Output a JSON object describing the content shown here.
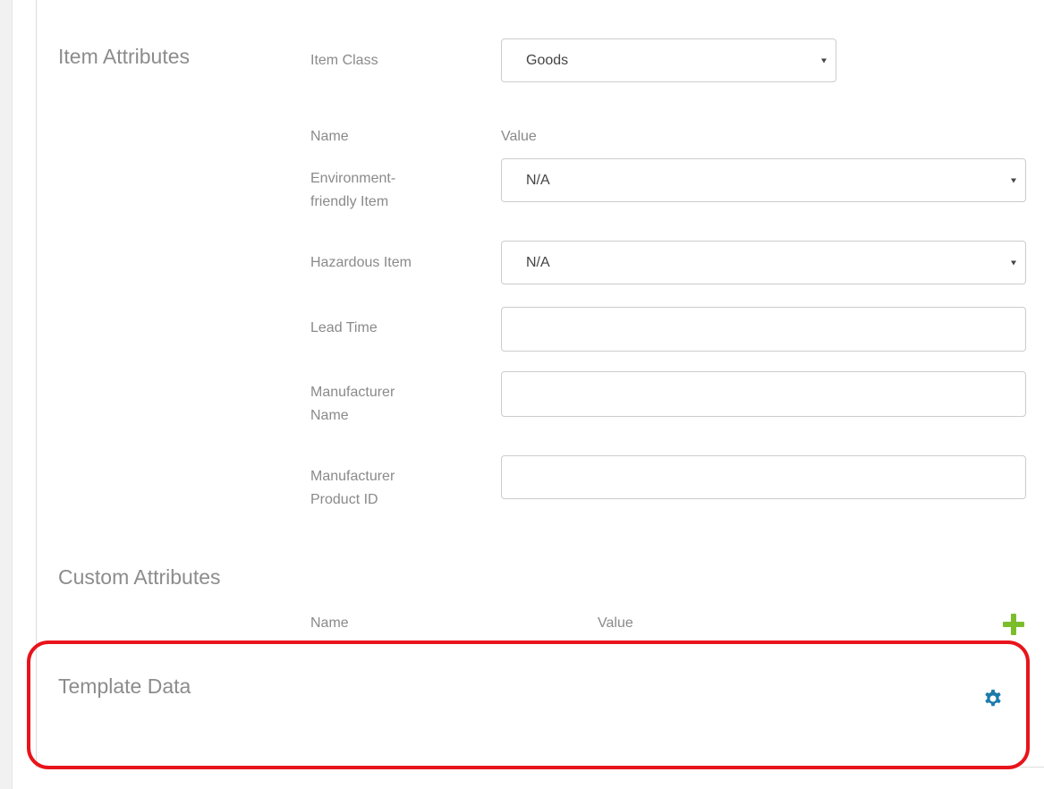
{
  "item_attributes": {
    "title": "Item Attributes",
    "item_class_label": "Item Class",
    "item_class_value": "Goods",
    "col_name": "Name",
    "col_value": "Value",
    "fields": [
      {
        "label_line1": "Environment-",
        "label_line2": "friendly Item",
        "value": "N/A"
      },
      {
        "label": "Hazardous Item",
        "value": "N/A"
      },
      {
        "label": "Lead Time",
        "value": ""
      },
      {
        "label_line1": "Manufacturer",
        "label_line2": "Name",
        "value": ""
      },
      {
        "label_line1": "Manufacturer",
        "label_line2": "Product ID",
        "value": ""
      }
    ]
  },
  "custom_attributes": {
    "title": "Custom Attributes",
    "col_name": "Name",
    "col_value": "Value",
    "add_icon": "plus-icon"
  },
  "template_data": {
    "title": "Template Data",
    "settings_icon": "gear-icon"
  },
  "colors": {
    "accent_green": "#7cbd2c",
    "gear_blue": "#1d7bab",
    "highlight_red": "#e8141b",
    "text_gray": "#8a8a8a"
  }
}
